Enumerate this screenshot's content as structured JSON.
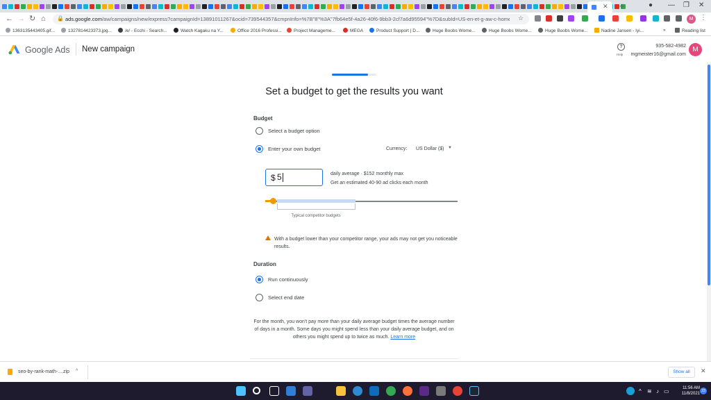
{
  "browser": {
    "url_host": "ads.google.com",
    "url_path": "/aw/campaigns/new/express?campaignId=13891011267&ocid=739544357&cmpnInfo=%7B\"8\"%3A\"7fb64e5f-4a26-40f6-9bb3-2cf7a6d95594\"%7D&subId=US-en-et-g-aw-c-home..."
  },
  "bookmarks": [
    {
      "label": "1363135443405.gif..."
    },
    {
      "label": "1327814423373.jpg..."
    },
    {
      "label": "/e/ - Ecchi - Search..."
    },
    {
      "label": "Watch Kagaku na Y..."
    },
    {
      "label": "Office 2016 Professi..."
    },
    {
      "label": "Project Manageme..."
    },
    {
      "label": "MEGA"
    },
    {
      "label": "Product Support | D..."
    },
    {
      "label": "Huge Boobs Wome..."
    },
    {
      "label": "Huge Boobs Wome..."
    },
    {
      "label": "Huge Boobs Wome..."
    },
    {
      "label": "Nadine Jansen - Iyi..."
    }
  ],
  "reading_list": "Reading list",
  "ads_header": {
    "brand": "Google Ads",
    "page_title": "New campaign",
    "help_label": "Help",
    "account_id": "935-582-4982",
    "account_email": "mgmeister16@gmail.com",
    "avatar_letter": "M"
  },
  "wizard": {
    "progress_fraction": 0.82,
    "headline": "Set a budget to get the results you want",
    "budget": {
      "label": "Budget",
      "option_select": "Select a budget option",
      "option_own": "Enter your own budget",
      "currency_label": "Currency:",
      "currency_value": "US Dollar ($)",
      "currency_symbol": "$",
      "amount": "5",
      "meta_line1": "daily average  ·  $152 monthly max",
      "meta_line2": "Get an estimated 40-90 ad clicks each month",
      "band_label": "Typical competitor budgets",
      "warning": "With a budget lower than your competitor range, your ads may not get you noticeable results."
    },
    "duration": {
      "label": "Duration",
      "option_continuous": "Run continuously",
      "option_end_date": "Select end date"
    },
    "footnote": "For the month, you won't pay more than your daily average budget times the average number of days in a month. Some days you might spend less than your daily average budget, and on others you might spend up to twice as much.",
    "learn_more": "Learn more"
  },
  "download": {
    "filename": "seo-by-rank-math-....zip",
    "show_all": "Show all"
  },
  "taskbar": {
    "time": "11:56 AM",
    "date": "11/8/2021",
    "notification_count": "23"
  },
  "colors": {
    "accent": "#1a73e8",
    "warning": "#e37400",
    "slider": "#f29900",
    "avatar": "#e8457c"
  }
}
